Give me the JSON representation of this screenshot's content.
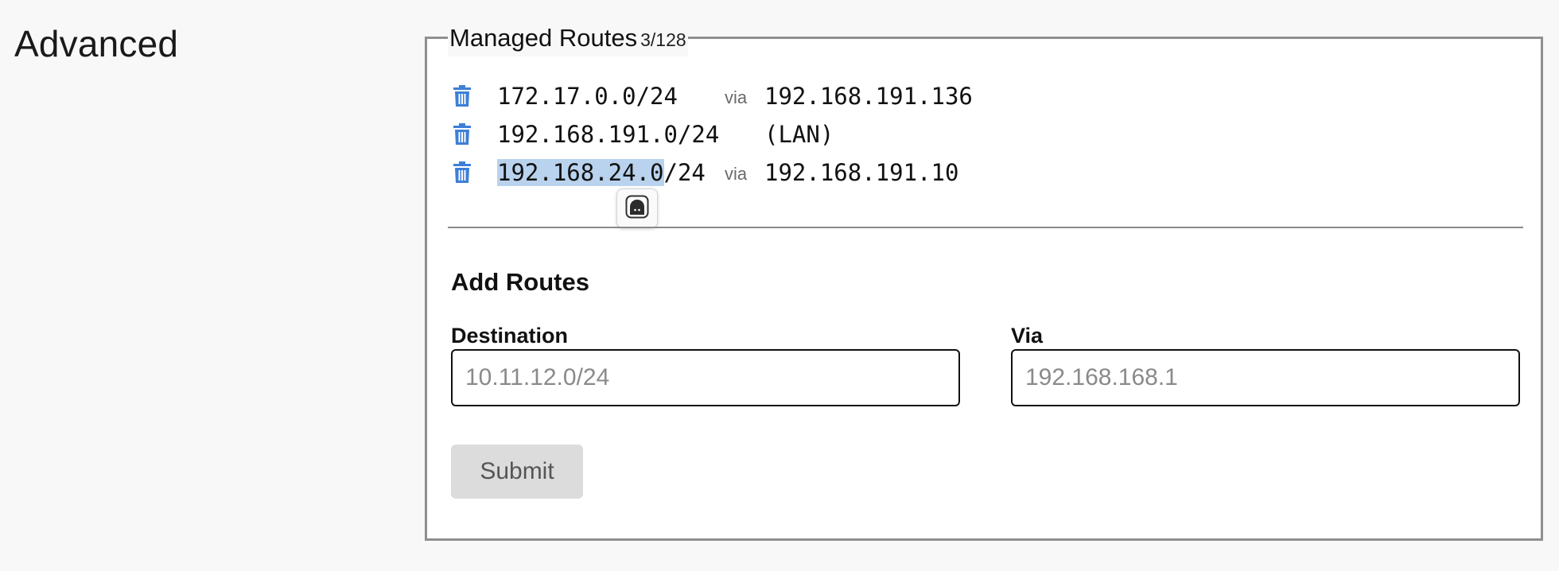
{
  "section": {
    "title": "Advanced"
  },
  "managed_routes": {
    "title": "Managed Routes",
    "count": "3/128",
    "routes": [
      {
        "destination": "172.17.0.0/24",
        "via_label": "via",
        "gateway": "192.168.191.136"
      },
      {
        "destination": "192.168.191.0/24",
        "via_label": "",
        "gateway": "(LAN)"
      },
      {
        "destination_highlighted": "192.168.24.0",
        "destination_rest": "/24",
        "via_label": "via",
        "gateway": "192.168.191.10"
      }
    ],
    "delete_icon": "trash-icon",
    "popup_icon": "assistant-face-icon"
  },
  "add_routes": {
    "heading": "Add Routes",
    "destination_label": "Destination",
    "destination_placeholder": "10.11.12.0/24",
    "destination_value": "",
    "via_label": "Via",
    "via_placeholder": "192.168.168.1",
    "via_value": "",
    "submit_label": "Submit"
  },
  "colors": {
    "icon_blue": "#3d7fd6",
    "selection": "#b9d3ee",
    "button_disabled": "#dcdcdc"
  }
}
